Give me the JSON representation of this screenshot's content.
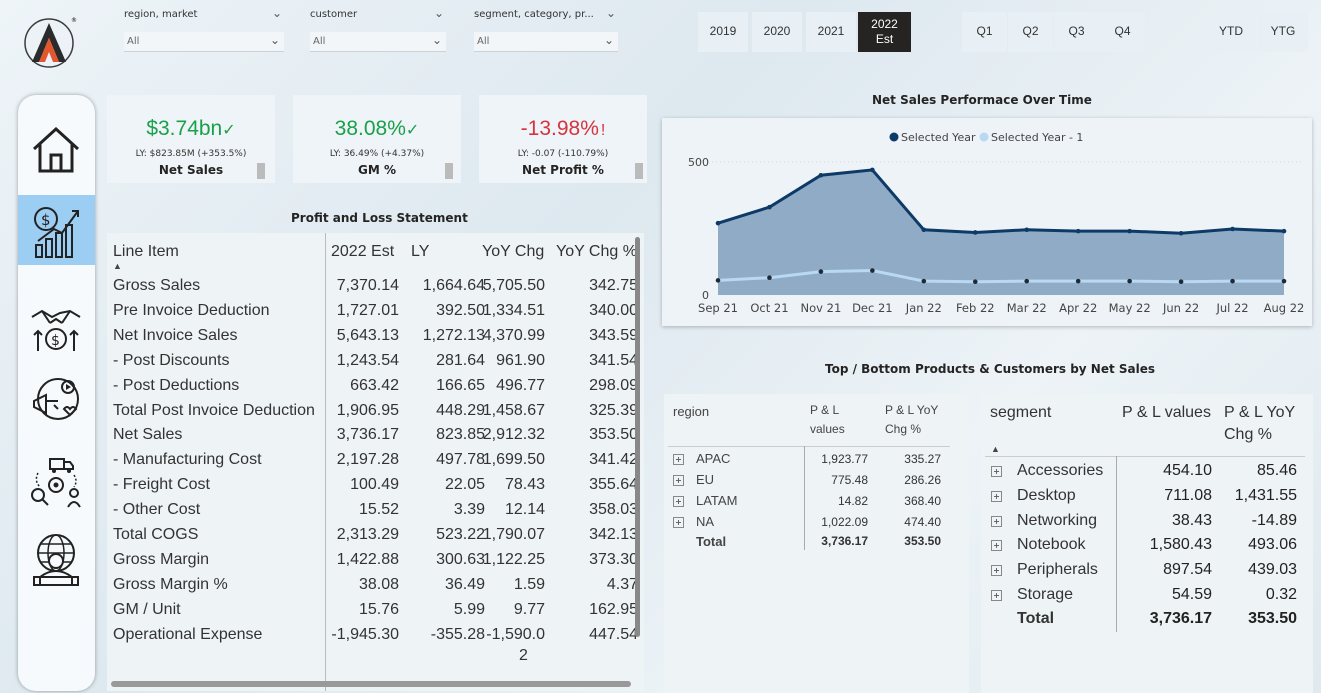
{
  "slicers": [
    {
      "label": "region, market",
      "value": "All"
    },
    {
      "label": "customer",
      "value": "All"
    },
    {
      "label": "segment, category, pr...",
      "value": "All"
    }
  ],
  "years": [
    "2019",
    "2020",
    "2021"
  ],
  "selected_year": {
    "line1": "2022",
    "line2": "Est"
  },
  "quarters": [
    "Q1",
    "Q2",
    "Q3",
    "Q4"
  ],
  "ytd": "YTD",
  "ytg": "YTG",
  "nav_icons": [
    "home-icon",
    "finance-icon",
    "sales-icon",
    "marketing-icon",
    "supply-chain-icon",
    "executive-icon"
  ],
  "kpis": [
    {
      "value": "$3.74bn",
      "mark": "✓",
      "ly": "LY: $823.85M (+353.5%)",
      "title": "Net Sales",
      "color": "#1aa04a"
    },
    {
      "value": "38.08%",
      "mark": "✓",
      "ly": "LY: 36.49% (+4.37%)",
      "title": "GM %",
      "color": "#1aa04a"
    },
    {
      "value": "-13.98%",
      "mark": "!",
      "ly": "LY: -0.07 (-110.79%)",
      "title": "Net Profit %",
      "color": "#d6333f"
    }
  ],
  "pl_title": "Profit and Loss Statement",
  "pl_headers": [
    "Line Item",
    "2022 Est",
    "LY",
    "YoY Chg",
    "YoY Chg %"
  ],
  "pl_rows": [
    [
      "Gross Sales",
      "7,370.14",
      "1,664.64",
      "5,705.50",
      "342.75"
    ],
    [
      "Pre Invoice Deduction",
      "1,727.01",
      "392.50",
      "1,334.51",
      "340.00"
    ],
    [
      "Net Invoice Sales",
      "5,643.13",
      "1,272.13",
      "4,370.99",
      "343.59"
    ],
    [
      "- Post Discounts",
      "1,243.54",
      "281.64",
      "961.90",
      "341.54"
    ],
    [
      "- Post Deductions",
      "663.42",
      "166.65",
      "496.77",
      "298.09"
    ],
    [
      "Total Post Invoice Deduction",
      "1,906.95",
      "448.29",
      "1,458.67",
      "325.39"
    ],
    [
      "Net Sales",
      "3,736.17",
      "823.85",
      "2,912.32",
      "353.50"
    ],
    [
      "- Manufacturing Cost",
      "2,197.28",
      "497.78",
      "1,699.50",
      "341.42"
    ],
    [
      "- Freight Cost",
      "100.49",
      "22.05",
      "78.43",
      "355.64"
    ],
    [
      "- Other Cost",
      "15.52",
      "3.39",
      "12.14",
      "358.03"
    ],
    [
      "Total COGS",
      "2,313.29",
      "523.22",
      "1,790.07",
      "342.13"
    ],
    [
      "Gross Margin",
      "1,422.88",
      "300.63",
      "1,122.25",
      "373.30"
    ],
    [
      "Gross Margin %",
      "38.08",
      "36.49",
      "1.59",
      "4.37"
    ],
    [
      "GM / Unit",
      "15.76",
      "5.99",
      "9.77",
      "162.95"
    ],
    [
      "Operational Expense",
      "-1,945.30",
      "-355.28",
      "-1,590.0",
      "447.54"
    ]
  ],
  "pl_wrap": "2",
  "chart_title": "Net Sales Performace Over Time",
  "chart_data": {
    "type": "area",
    "categories": [
      "Sep 21",
      "Oct 21",
      "Nov 21",
      "Dec 21",
      "Jan 22",
      "Feb 22",
      "Mar 22",
      "Apr 22",
      "May 22",
      "Jun 22",
      "Jul 22",
      "Aug 22"
    ],
    "series": [
      {
        "name": "Selected Year",
        "color": "#0d3a66",
        "values": [
          270,
          330,
          450,
          470,
          245,
          235,
          245,
          240,
          240,
          232,
          248,
          240
        ]
      },
      {
        "name": "Selected Year - 1",
        "color": "#b9d8f1",
        "values": [
          55,
          65,
          88,
          92,
          52,
          50,
          52,
          52,
          52,
          50,
          52,
          52
        ]
      }
    ],
    "yticks": [
      "500",
      "0"
    ],
    "ylim": [
      0,
      620
    ]
  },
  "top_title": "Top / Bottom Products & Customers by Net Sales",
  "region_table": {
    "headers": [
      "region",
      "P & L",
      "values",
      "P & L YoY",
      "Chg %"
    ],
    "rows": [
      [
        "APAC",
        "1,923.77",
        "335.27"
      ],
      [
        "EU",
        "775.48",
        "286.26"
      ],
      [
        "LATAM",
        "14.82",
        "368.40"
      ],
      [
        "NA",
        "1,022.09",
        "474.40"
      ]
    ],
    "total": [
      "Total",
      "3,736.17",
      "353.50"
    ]
  },
  "segment_table": {
    "headers": [
      "segment",
      "P & L values",
      "P & L YoY",
      "Chg %"
    ],
    "rows": [
      [
        "Accessories",
        "454.10",
        "85.46"
      ],
      [
        "Desktop",
        "711.08",
        "1,431.55"
      ],
      [
        "Networking",
        "38.43",
        "-14.89"
      ],
      [
        "Notebook",
        "1,580.43",
        "493.06"
      ],
      [
        "Peripherals",
        "897.54",
        "439.03"
      ],
      [
        "Storage",
        "54.59",
        "0.32"
      ]
    ],
    "total": [
      "Total",
      "3,736.17",
      "353.50"
    ]
  }
}
